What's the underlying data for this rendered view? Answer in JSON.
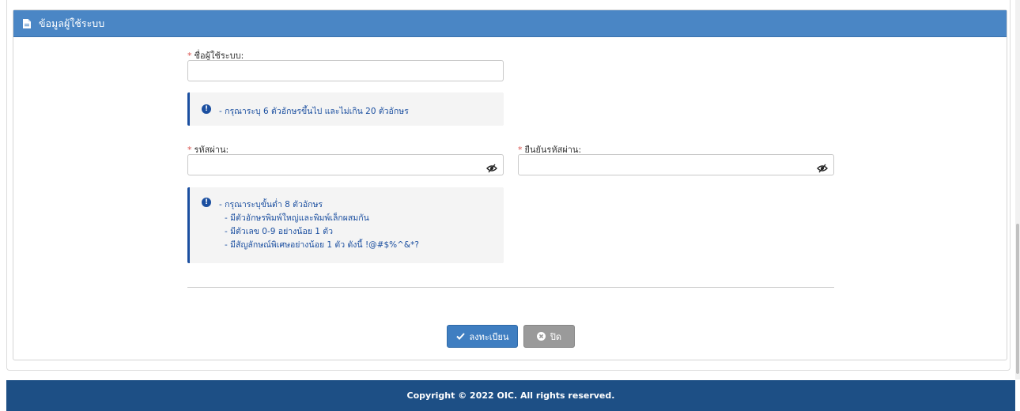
{
  "panel": {
    "title": "ข้อมูลผู้ใช้ระบบ"
  },
  "username": {
    "label": "ชื่อผู้ใช้ระบบ:",
    "required_mark": "*",
    "value": "",
    "placeholder": ""
  },
  "username_info": {
    "lines": [
      "- กรุณาระบุ 6 ตัวอักษรขึ้นไป และไม่เกิน 20 ตัวอักษร"
    ]
  },
  "password": {
    "label": "รหัสผ่าน:",
    "required_mark": "*",
    "value": "",
    "placeholder": ""
  },
  "confirm_password": {
    "label": "ยืนยันรหัสผ่าน:",
    "required_mark": "*",
    "value": "",
    "placeholder": ""
  },
  "password_info": {
    "lines": [
      "- กรุณาระบุขั้นต่ำ 8 ตัวอักษร",
      "- มีตัวอักษรพิมพ์ใหญ่และพิมพ์เล็กผสมกัน",
      "- มีตัวเลข 0-9 อย่างน้อย 1 ตัว",
      "- มีสัญลักษณ์พิเศษอย่างน้อย 1 ตัว ดังนี้ !@#$%^&*?"
    ]
  },
  "buttons": {
    "register": "ลงทะเบียน",
    "close": "ปิด"
  },
  "footer": {
    "copyright": "Copyright © 2022 OIC. All rights reserved."
  },
  "colors": {
    "header": "#4a86c5",
    "info_accent": "#1b4fa0",
    "required": "#d9534f",
    "footer": "#1d4f85",
    "primary_button": "#3f7ec1",
    "default_button": "#9a9a9a"
  },
  "icons": {
    "header": "document-icon",
    "info": "info-circle-icon",
    "password_toggle": "eye-slash-icon",
    "register": "check-icon",
    "close": "times-circle-icon"
  }
}
